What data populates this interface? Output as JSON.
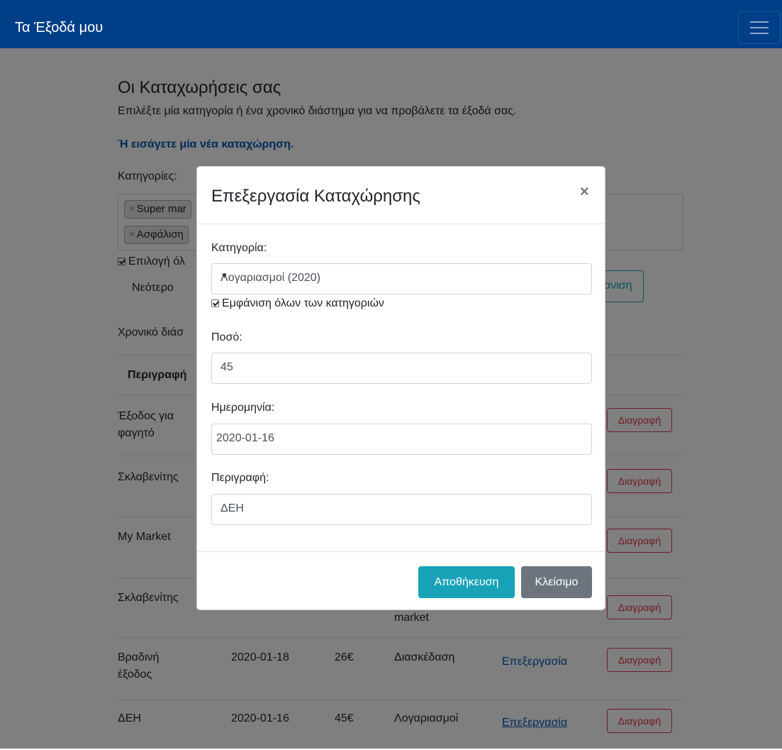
{
  "navbar": {
    "brand": "Τα Έξοδά μου"
  },
  "page": {
    "title": "Οι Καταχωρήσεις σας",
    "subtitle": "Επιλέξτε μία κατηγορία ή ένα χρονικό διάστημα για να προβάλετε τα έξοδά σας.",
    "new_entry_link": "Ή εισάγετε μία νέα καταχώρηση.",
    "categories_label": "Κατηγορίες:",
    "chips": [
      "Super mar",
      "Ασφάλιση"
    ],
    "select_all_label": "Επιλογή όλ",
    "newer_label": "Νεότερο",
    "refresh_label": "ανιση",
    "period_label": "Χρονικό διάσ"
  },
  "table": {
    "header_description": "Περιγραφή",
    "rows": [
      {
        "desc_line1": "Έξοδος για",
        "desc_line2": "φαγητό",
        "delete": "Διαγραφή"
      },
      {
        "desc_line1": "Σκλαβενίτης",
        "desc_line2": "",
        "delete": "Διαγραφή"
      },
      {
        "desc_line1": "My Market",
        "desc_line2": "",
        "delete": "Διαγραφή"
      },
      {
        "desc_line1": "Σκλαβενίτης",
        "desc_line2": "",
        "cat_partial": "market",
        "delete": "Διαγραφή"
      },
      {
        "desc_line1": "Βραδινή",
        "desc_line2": "έξοδος",
        "date": "2020-01-18",
        "amount": "26€",
        "category": "Διασκέδαση",
        "edit": "Επεξεργασία",
        "delete": "Διαγραφή"
      },
      {
        "desc_line1": "ΔΕΗ",
        "desc_line2": "",
        "date": "2020-01-16",
        "amount": "45€",
        "category": "Λογαριασμοί",
        "edit": "Επεξεργασία",
        "delete": "Διαγραφή"
      }
    ]
  },
  "modal": {
    "title": "Επεξεργασία Καταχώρησης",
    "close_symbol": "×",
    "category_label": "Κατηγορία:",
    "category_value": "Λογαριασμοί (2020)",
    "show_all_label": "Εμφάνιση όλων των κατηγοριών",
    "amount_label": "Ποσό:",
    "amount_value": "45",
    "date_label": "Ημερομηνία:",
    "date_value": "2020-01-16",
    "description_label": "Περιγραφή:",
    "description_value": "ΔΕΗ",
    "save_button": "Αποθήκευση",
    "close_button": "Κλείσιμο"
  },
  "colors": {
    "navbar": "#003f87",
    "info": "#17a2b8",
    "danger": "#dc3545",
    "secondary": "#6c757d",
    "link": "#0056b3"
  },
  "icons": {
    "menu": "hamburger-icon",
    "close": "close-icon",
    "caret": "caret-down-icon",
    "chip_remove": "remove-icon"
  }
}
